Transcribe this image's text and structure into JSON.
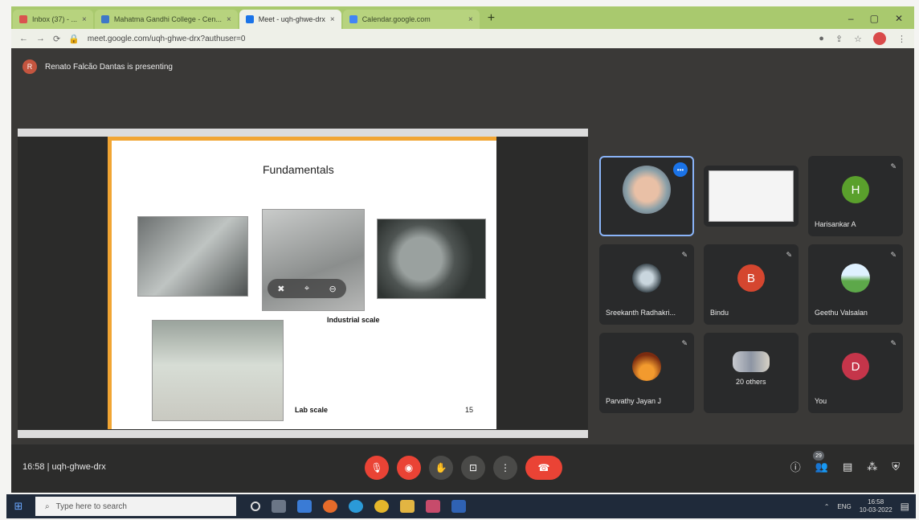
{
  "browser": {
    "tabs": [
      {
        "label": "Inbox (37) - ...",
        "color": "#d9534f"
      },
      {
        "label": "Mahatma Gandhi College - Cen...",
        "color": "#3e77c8"
      },
      {
        "label": "Meet - uqh-ghwe-drx",
        "color": "#1a73e8",
        "active": true
      },
      {
        "label": "Calendar.google.com",
        "color": "#4285f4"
      }
    ],
    "new_tab": "+",
    "url": "meet.google.com/uqh-ghwe-drx?authuser=0"
  },
  "meet": {
    "presenter_initial": "R",
    "presenting_text": "Renato Falcão Dantas is presenting",
    "slide": {
      "title": "Fundamentals",
      "caption_industrial": "Industrial scale",
      "caption_lab": "Lab scale",
      "page_number": "15"
    },
    "tiles": [
      {
        "name": "",
        "type": "video"
      },
      {
        "name": "",
        "type": "screen"
      },
      {
        "name": "Harisankar A",
        "initial": "H",
        "color": "#5aa02c"
      },
      {
        "name": "Sreekanth Radhakri...",
        "type": "photo"
      },
      {
        "name": "Bindu",
        "initial": "B",
        "color": "#d5462f"
      },
      {
        "name": "Geethu Valsalan",
        "type": "photo"
      },
      {
        "name": "Parvathy Jayan J",
        "type": "photo"
      },
      {
        "name": "20 others",
        "type": "group"
      },
      {
        "name": "You",
        "initial": "D",
        "color": "#c5354a"
      }
    ],
    "time": "16:58",
    "meeting_code": "uqh-ghwe-drx",
    "participant_count": "29"
  },
  "taskbar": {
    "search_placeholder": "Type here to search",
    "lang": "ENG",
    "clock_time": "16:58",
    "clock_date": "10-03-2022"
  }
}
